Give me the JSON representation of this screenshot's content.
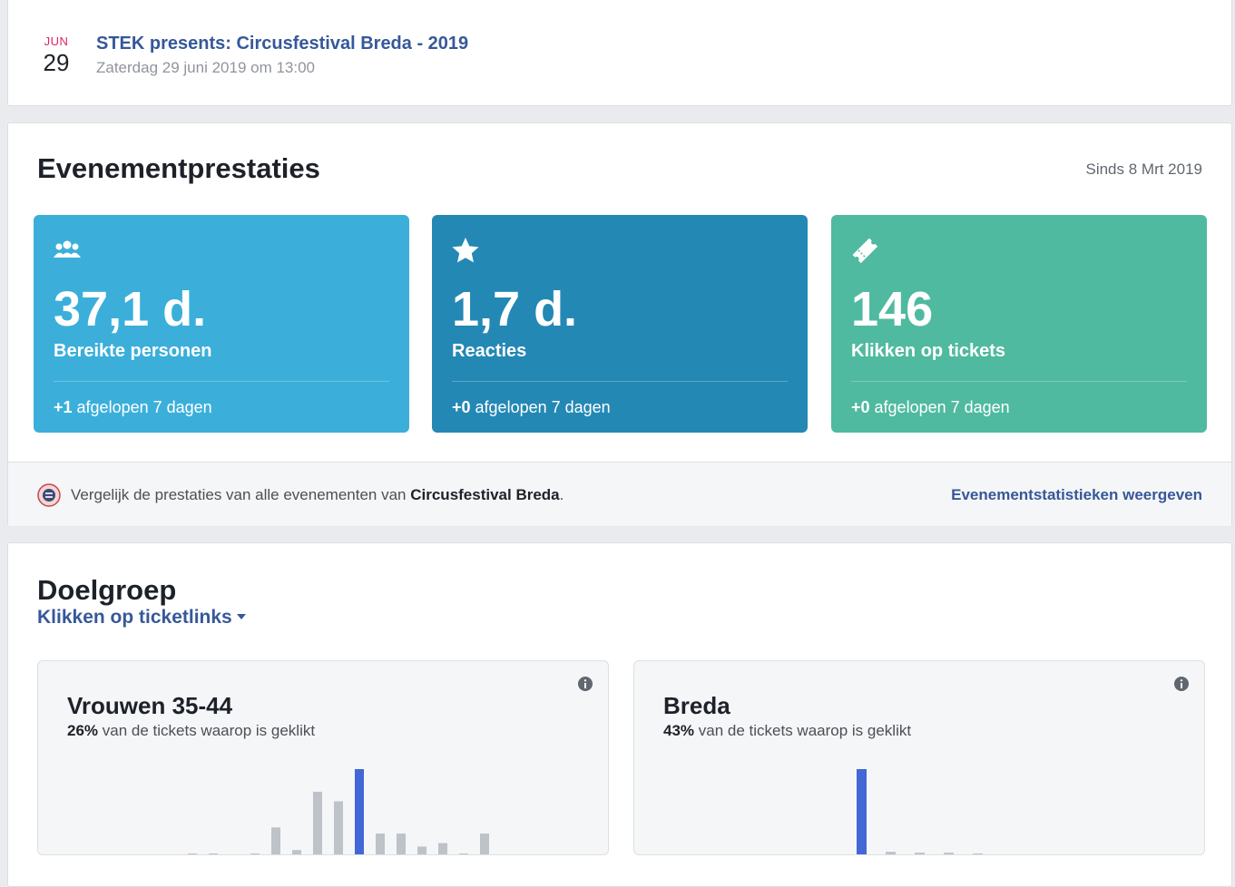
{
  "event": {
    "month": "JUN",
    "day": "29",
    "title": "STEK presents: Circusfestival Breda - 2019",
    "subtitle": "Zaterdag 29 juni 2019 om 13:00"
  },
  "performance": {
    "title": "Evenementprestaties",
    "since": "Sinds 8 Mrt 2019",
    "tiles": [
      {
        "icon": "people-icon",
        "value": "37,1 d.",
        "label": "Bereikte personen",
        "delta": "+1",
        "period": " afgelopen 7 dagen",
        "color": "#3bafda"
      },
      {
        "icon": "star-icon",
        "value": "1,7 d.",
        "label": "Reacties",
        "delta": "+0",
        "period": " afgelopen 7 dagen",
        "color": "#2488b4"
      },
      {
        "icon": "ticket-icon",
        "value": "146",
        "label": "Klikken op tickets",
        "delta": "+0",
        "period": " afgelopen 7 dagen",
        "color": "#4fbaa0"
      }
    ],
    "compare": {
      "text_prefix": "Vergelijk de prestaties van alle evenementen van ",
      "page_name": "Circusfestival Breda",
      "text_suffix": ".",
      "link": "Evenementstatistieken weergeven"
    }
  },
  "audience": {
    "title": "Doelgroep",
    "filter": "Klikken op ticketlinks",
    "cards": [
      {
        "title": "Vrouwen 35-44",
        "percent": "26%",
        "desc": " van de tickets waarop is geklikt",
        "bars": [
          0.01,
          0.01,
          0,
          0.01,
          0.33,
          0.07,
          0.74,
          0.63,
          1.0,
          0.26,
          0.26,
          0.11,
          0.15,
          0.02,
          0.26
        ],
        "highlight_index": 8
      },
      {
        "title": "Breda",
        "percent": "43%",
        "desc": " van de tickets waarop is geklikt",
        "bars": [
          1.0,
          0.05,
          0.04,
          0.04,
          0.03
        ],
        "highlight_index": 0
      }
    ],
    "colors": {
      "highlight": "#4267d6",
      "muted": "#bec2c9"
    }
  }
}
